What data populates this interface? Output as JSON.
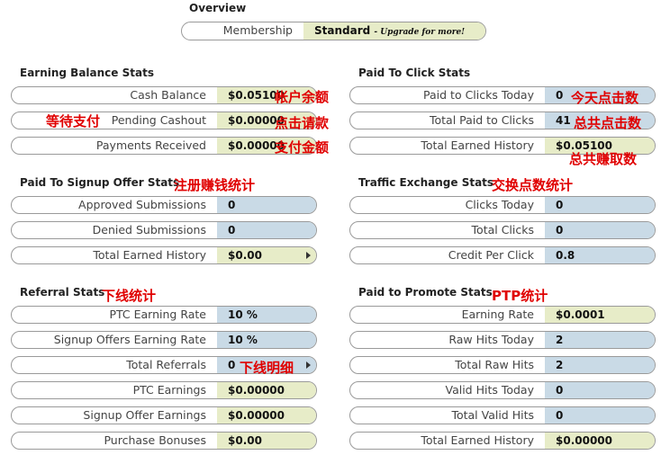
{
  "overview": {
    "title": "Overview",
    "membership_label": "Membership",
    "membership_value": "Standard",
    "upgrade_text": "- Upgrade for more!"
  },
  "earning": {
    "title": "Earning Balance Stats",
    "rows": [
      {
        "label": "Cash Balance",
        "value": "$0.05100"
      },
      {
        "label": "Pending Cashout",
        "value": "$0.00000"
      },
      {
        "label": "Payments Received",
        "value": "$0.00000"
      }
    ]
  },
  "ptc": {
    "title": "Paid To Click Stats",
    "rows": [
      {
        "label": "Paid to Clicks Today",
        "value": "0"
      },
      {
        "label": "Total Paid to Clicks",
        "value": "41"
      },
      {
        "label": "Total Earned History",
        "value": "$0.05100"
      }
    ]
  },
  "signup": {
    "title": "Paid To Signup Offer Stats",
    "rows": [
      {
        "label": "Approved Submissions",
        "value": "0"
      },
      {
        "label": "Denied Submissions",
        "value": "0"
      },
      {
        "label": "Total Earned History",
        "value": "$0.00"
      }
    ]
  },
  "traffic": {
    "title": "Traffic Exchange Stats",
    "rows": [
      {
        "label": "Clicks Today",
        "value": "0"
      },
      {
        "label": "Total Clicks",
        "value": "0"
      },
      {
        "label": "Credit Per Click",
        "value": "0.8"
      }
    ]
  },
  "referral": {
    "title": "Referral Stats",
    "rows": [
      {
        "label": "PTC Earning Rate",
        "value": "10 %"
      },
      {
        "label": "Signup Offers Earning Rate",
        "value": "10 %"
      },
      {
        "label": "Total Referrals",
        "value": "0"
      },
      {
        "label": "PTC Earnings",
        "value": "$0.00000"
      },
      {
        "label": "Signup Offer Earnings",
        "value": "$0.00000"
      },
      {
        "label": "Purchase Bonuses",
        "value": "$0.00"
      }
    ]
  },
  "ptp": {
    "title": "Paid to Promote Stats",
    "rows": [
      {
        "label": "Earning Rate",
        "value": "$0.0001"
      },
      {
        "label": "Raw Hits Today",
        "value": "2"
      },
      {
        "label": "Total Raw Hits",
        "value": "2"
      },
      {
        "label": "Valid Hits Today",
        "value": "0"
      },
      {
        "label": "Total Valid Hits",
        "value": "0"
      },
      {
        "label": "Total Earned History",
        "value": "$0.00000"
      }
    ]
  },
  "annotations": {
    "account_balance": "帐户余额",
    "pending_payment": "等待支付",
    "click_request": "点击请款",
    "payment_amount": "支付金额",
    "today_clicks": "今天点击数",
    "total_clicks": "总共点击数",
    "total_earned_clicks": "总共赚取数",
    "signup_stats": "注册赚钱统计",
    "exchange_stats": "交换点数统计",
    "referral_stats": "下线统计",
    "ptp_stats": "PTP统计",
    "referral_details": "下线明细"
  }
}
